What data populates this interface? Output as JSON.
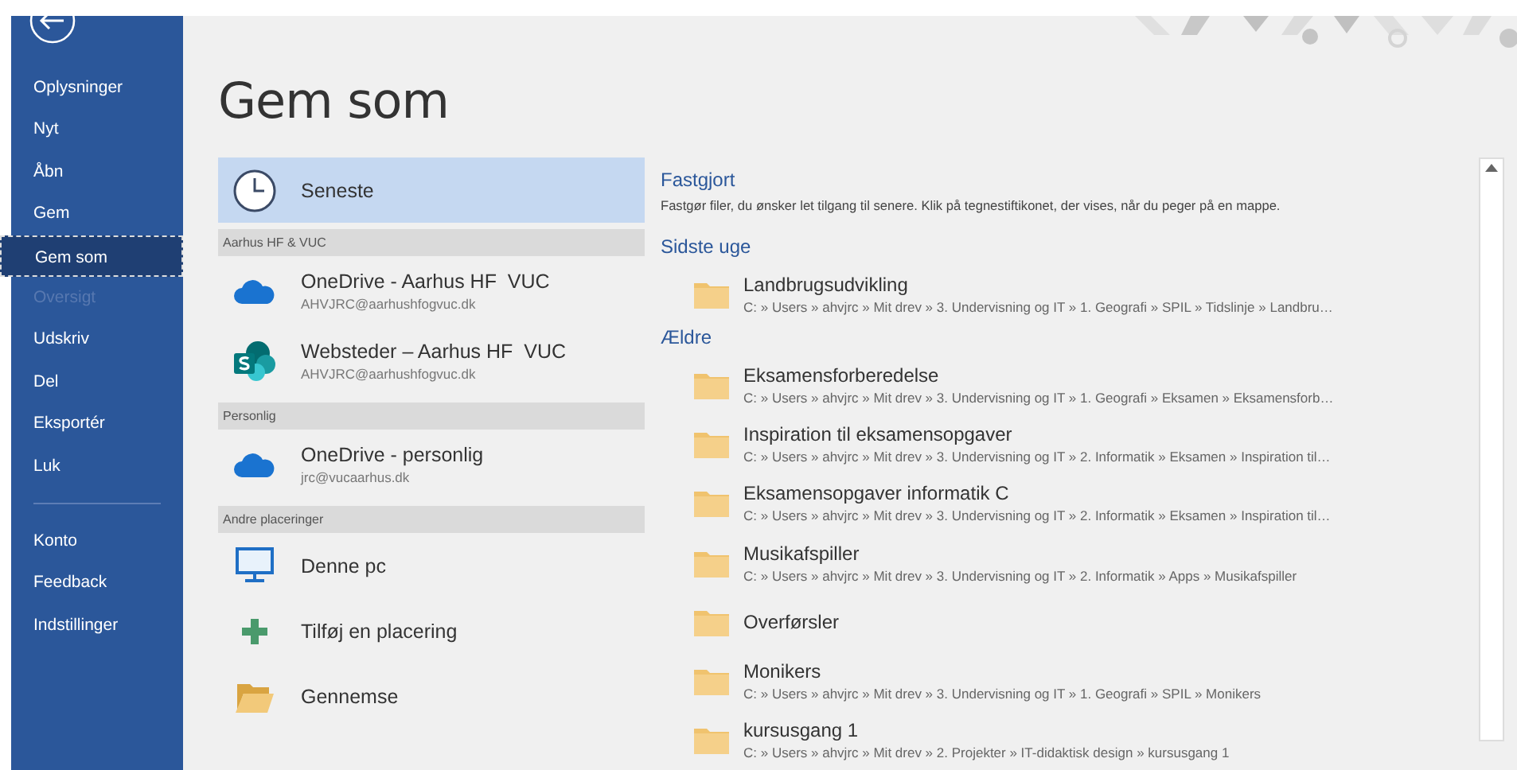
{
  "sidebar": {
    "items": [
      {
        "label": "Oplysninger",
        "selected": false,
        "disabled": false
      },
      {
        "label": "Nyt",
        "selected": false,
        "disabled": false
      },
      {
        "label": "Åbn",
        "selected": false,
        "disabled": false
      },
      {
        "label": "Gem",
        "selected": false,
        "disabled": false
      },
      {
        "label": "Gem som",
        "selected": true,
        "disabled": false
      },
      {
        "label": "Oversigt",
        "selected": false,
        "disabled": true
      },
      {
        "label": "Udskriv",
        "selected": false,
        "disabled": false
      },
      {
        "label": "Del",
        "selected": false,
        "disabled": false
      },
      {
        "label": "Eksportér",
        "selected": false,
        "disabled": false
      },
      {
        "label": "Luk",
        "selected": false,
        "disabled": false
      }
    ],
    "footer_items": [
      {
        "label": "Konto",
        "selected": false,
        "disabled": false
      },
      {
        "label": "Feedback",
        "selected": false,
        "disabled": false
      },
      {
        "label": "Indstillinger",
        "selected": false,
        "disabled": false
      }
    ]
  },
  "page_title": "Gem som",
  "locations": [
    {
      "kind": "item",
      "name": "Seneste",
      "selected": true
    },
    {
      "kind": "header",
      "name": "Aarhus HF & VUC"
    },
    {
      "kind": "item",
      "name": "OneDrive - Aarhus HF  VUC",
      "detail": "AHVJRC@aarhushfogvuc.dk",
      "selected": false
    },
    {
      "kind": "item",
      "name": "Websteder – Aarhus HF  VUC",
      "detail": "AHVJRC@aarhushfogvuc.dk",
      "selected": false
    },
    {
      "kind": "header",
      "name": "Personlig"
    },
    {
      "kind": "item",
      "name": "OneDrive - personlig",
      "detail": "jrc@vucaarhus.dk",
      "selected": false
    },
    {
      "kind": "header",
      "name": "Andre placeringer"
    },
    {
      "kind": "item",
      "name": "Denne pc",
      "selected": false
    },
    {
      "kind": "item",
      "name": "Tilføj en placering",
      "selected": false
    },
    {
      "kind": "item",
      "name": "Gennemse",
      "selected": false
    }
  ],
  "recent": [
    {
      "kind": "heading",
      "text": "Fastgjort"
    },
    {
      "kind": "note",
      "text": "Fastgør filer, du ønsker let tilgang til senere. Klik på tegnestiftikonet, der vises, når du peger på en mappe."
    },
    {
      "kind": "heading",
      "text": "Sidste uge"
    },
    {
      "kind": "folder",
      "name": "Landbrugsudvikling",
      "path": "C: » Users » ahvjrc » Mit drev » 3. Undervisning og IT » 1. Geografi » SPIL » Tidslinje » Landbru…"
    },
    {
      "kind": "heading",
      "text": "Ældre"
    },
    {
      "kind": "folder",
      "name": "Eksamensforberedelse",
      "path": "C: » Users » ahvjrc » Mit drev » 3. Undervisning og IT » 1. Geografi » Eksamen » Eksamensforb…"
    },
    {
      "kind": "folder",
      "name": "Inspiration til eksamensopgaver",
      "path": "C: » Users » ahvjrc » Mit drev » 3. Undervisning og IT » 2. Informatik » Eksamen » Inspiration til…"
    },
    {
      "kind": "folder",
      "name": "Eksamensopgaver informatik C",
      "path": "C: » Users » ahvjrc » Mit drev » 3. Undervisning og IT » 2. Informatik » Eksamen » Inspiration til…"
    },
    {
      "kind": "folder",
      "name": "Musikafspiller",
      "path": "C: » Users » ahvjrc » Mit drev » 3. Undervisning og IT » 2. Informatik » Apps » Musikafspiller"
    },
    {
      "kind": "folder",
      "name": "Overførsler"
    },
    {
      "kind": "folder",
      "name": "Monikers",
      "path": "C: » Users » ahvjrc » Mit drev » 3. Undervisning og IT » 1. Geografi » SPIL » Monikers"
    },
    {
      "kind": "folder",
      "name": "kursusgang 1",
      "path": "C: » Users » ahvjrc » Mit drev » 2. Projekter » IT-didaktisk design » kursusgang 1"
    }
  ]
}
